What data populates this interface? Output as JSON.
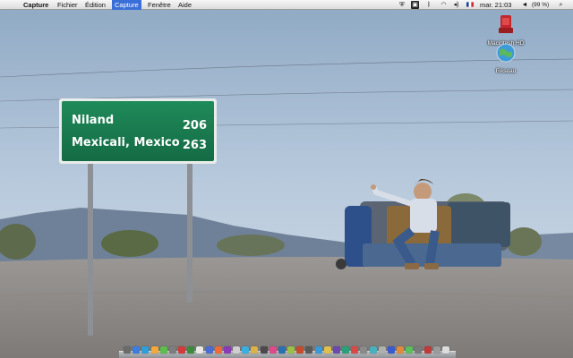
{
  "menubar": {
    "apple_icon": "apple-icon",
    "app_name": "Capture",
    "menus": [
      "Fichier",
      "Édition",
      "Capture",
      "Fenêtre",
      "Aide"
    ],
    "active_menu": "Capture",
    "status": {
      "clock": "mar. 21:03",
      "battery": "(99 %)",
      "flag_icon": "french-flag-icon",
      "icons": [
        "shield-icon",
        "screenshot-icon",
        "bluetooth-icon",
        "wifi-icon",
        "volume-icon",
        "input-flag-icon",
        "battery-icon",
        "search-icon"
      ]
    }
  },
  "desktop_icons": [
    {
      "name": "Macintosh HD",
      "icon": "hard-drive-icon"
    },
    {
      "name": "Réseau",
      "icon": "globe-network-icon"
    }
  ],
  "wallpaper": {
    "sign": {
      "line1_place": "Niland",
      "line1_miles": "206",
      "line2_place": "Mexicali, Mexico",
      "line2_miles": "263"
    }
  },
  "dock": {
    "icon_colors": [
      "#6b6b6b",
      "#3b7de0",
      "#2e9fd8",
      "#f2a93b",
      "#5bbf4a",
      "#7d7d7d",
      "#d33a3a",
      "#3a8c3a",
      "#e8e8e8",
      "#4b6cd4",
      "#f06a3a",
      "#8a3ab8",
      "#cfcfcf",
      "#3bb0e0",
      "#d9b24a",
      "#4a4a4a",
      "#e04a8a",
      "#2a6fb0",
      "#9bc04a",
      "#c94a2a",
      "#5a5a5a",
      "#3a9ad8",
      "#e0c04a",
      "#6a4ab0",
      "#2aa07a",
      "#d84a4a",
      "#8a8a8a",
      "#4ab0c0",
      "#b0b0b0",
      "#3a5ad0",
      "#e08a3a",
      "#5ac05a",
      "#7a7a7a",
      "#c03a3a",
      "#9a9a9a",
      "#dcdcdc"
    ]
  }
}
